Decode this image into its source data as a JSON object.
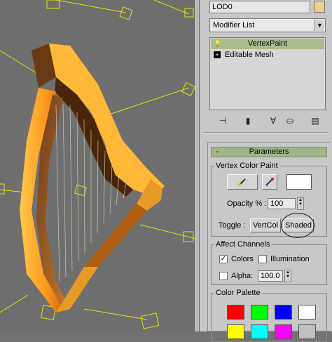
{
  "modify_panel": {
    "object_name": "LOD0",
    "object_color": "#e9d08c",
    "modifier_list": "Modifier List",
    "stack": [
      {
        "label": "VertexPaint",
        "icon": "lightbulb-icon",
        "selected": true
      },
      {
        "label": "Editable Mesh",
        "icon": "plus-expand-icon",
        "selected": false
      }
    ],
    "stack_tools": [
      "pin-stack-icon",
      "show-end-result-icon",
      "make-unique-icon",
      "remove-modifier-icon",
      "configure-modifier-sets-icon"
    ]
  },
  "parameters": {
    "title": "Parameters",
    "collapse_symbol": "-",
    "vertex_color_paint": {
      "group_title": "Vertex Color Paint",
      "paint_icon": "paint-brush-icon",
      "picker_icon": "eyedropper-icon",
      "paint_color": "#ffffff",
      "opacity_label": "Opacity % :",
      "opacity_value": "100",
      "toggle_label": "Toggle :",
      "vertcol_label": "VertCol",
      "shaded_label": "Shaded"
    },
    "affect_channels": {
      "group_title": "Affect Channels",
      "colors_label": "Colors",
      "colors_checked": true,
      "illumination_label": "Illumination",
      "illumination_checked": false,
      "alpha_label": "Alpha:",
      "alpha_checked": false,
      "alpha_value": "100.0"
    },
    "color_palette": {
      "group_title": "Color Palette",
      "swatches": [
        "#ff0000",
        "#00ff00",
        "#0000ff",
        "#ffffff",
        "#ffff00",
        "#00ffff",
        "#ff00ff",
        "#c0c0c0"
      ]
    }
  }
}
